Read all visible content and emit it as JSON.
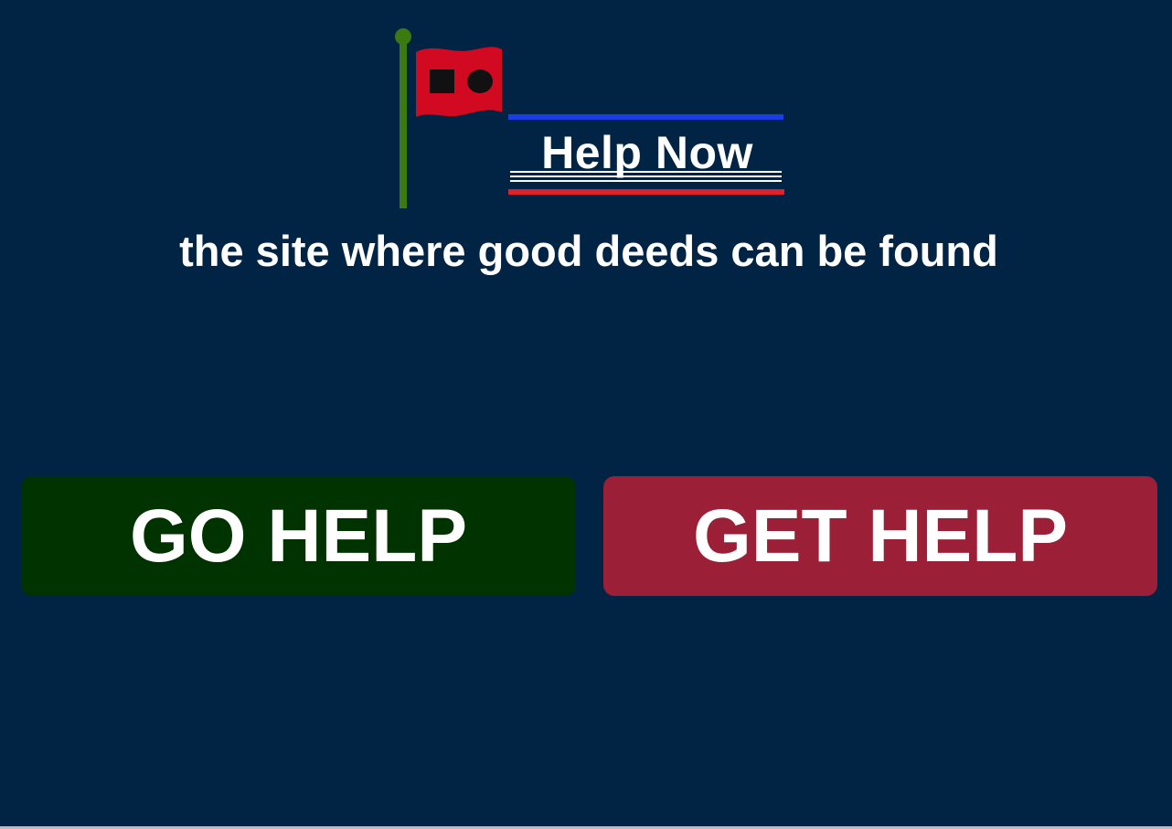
{
  "brand": {
    "name": "Help Now",
    "tagline": "the site where good deeds can be found"
  },
  "logo": {
    "icons": [
      "flag-icon",
      "flagpole-icon",
      "square-icon",
      "circle-icon"
    ]
  },
  "actions": {
    "go_help_label": "GO HELP",
    "get_help_label": "GET HELP"
  },
  "colors": {
    "background": "#022444",
    "go_help_button": "#013301",
    "get_help_button": "#9a1f37",
    "flag_red": "#d10a22",
    "pole_green": "#3a7a10",
    "rule_blue": "#1a3ee6",
    "rule_red": "#e0202a",
    "text": "#ffffff"
  }
}
